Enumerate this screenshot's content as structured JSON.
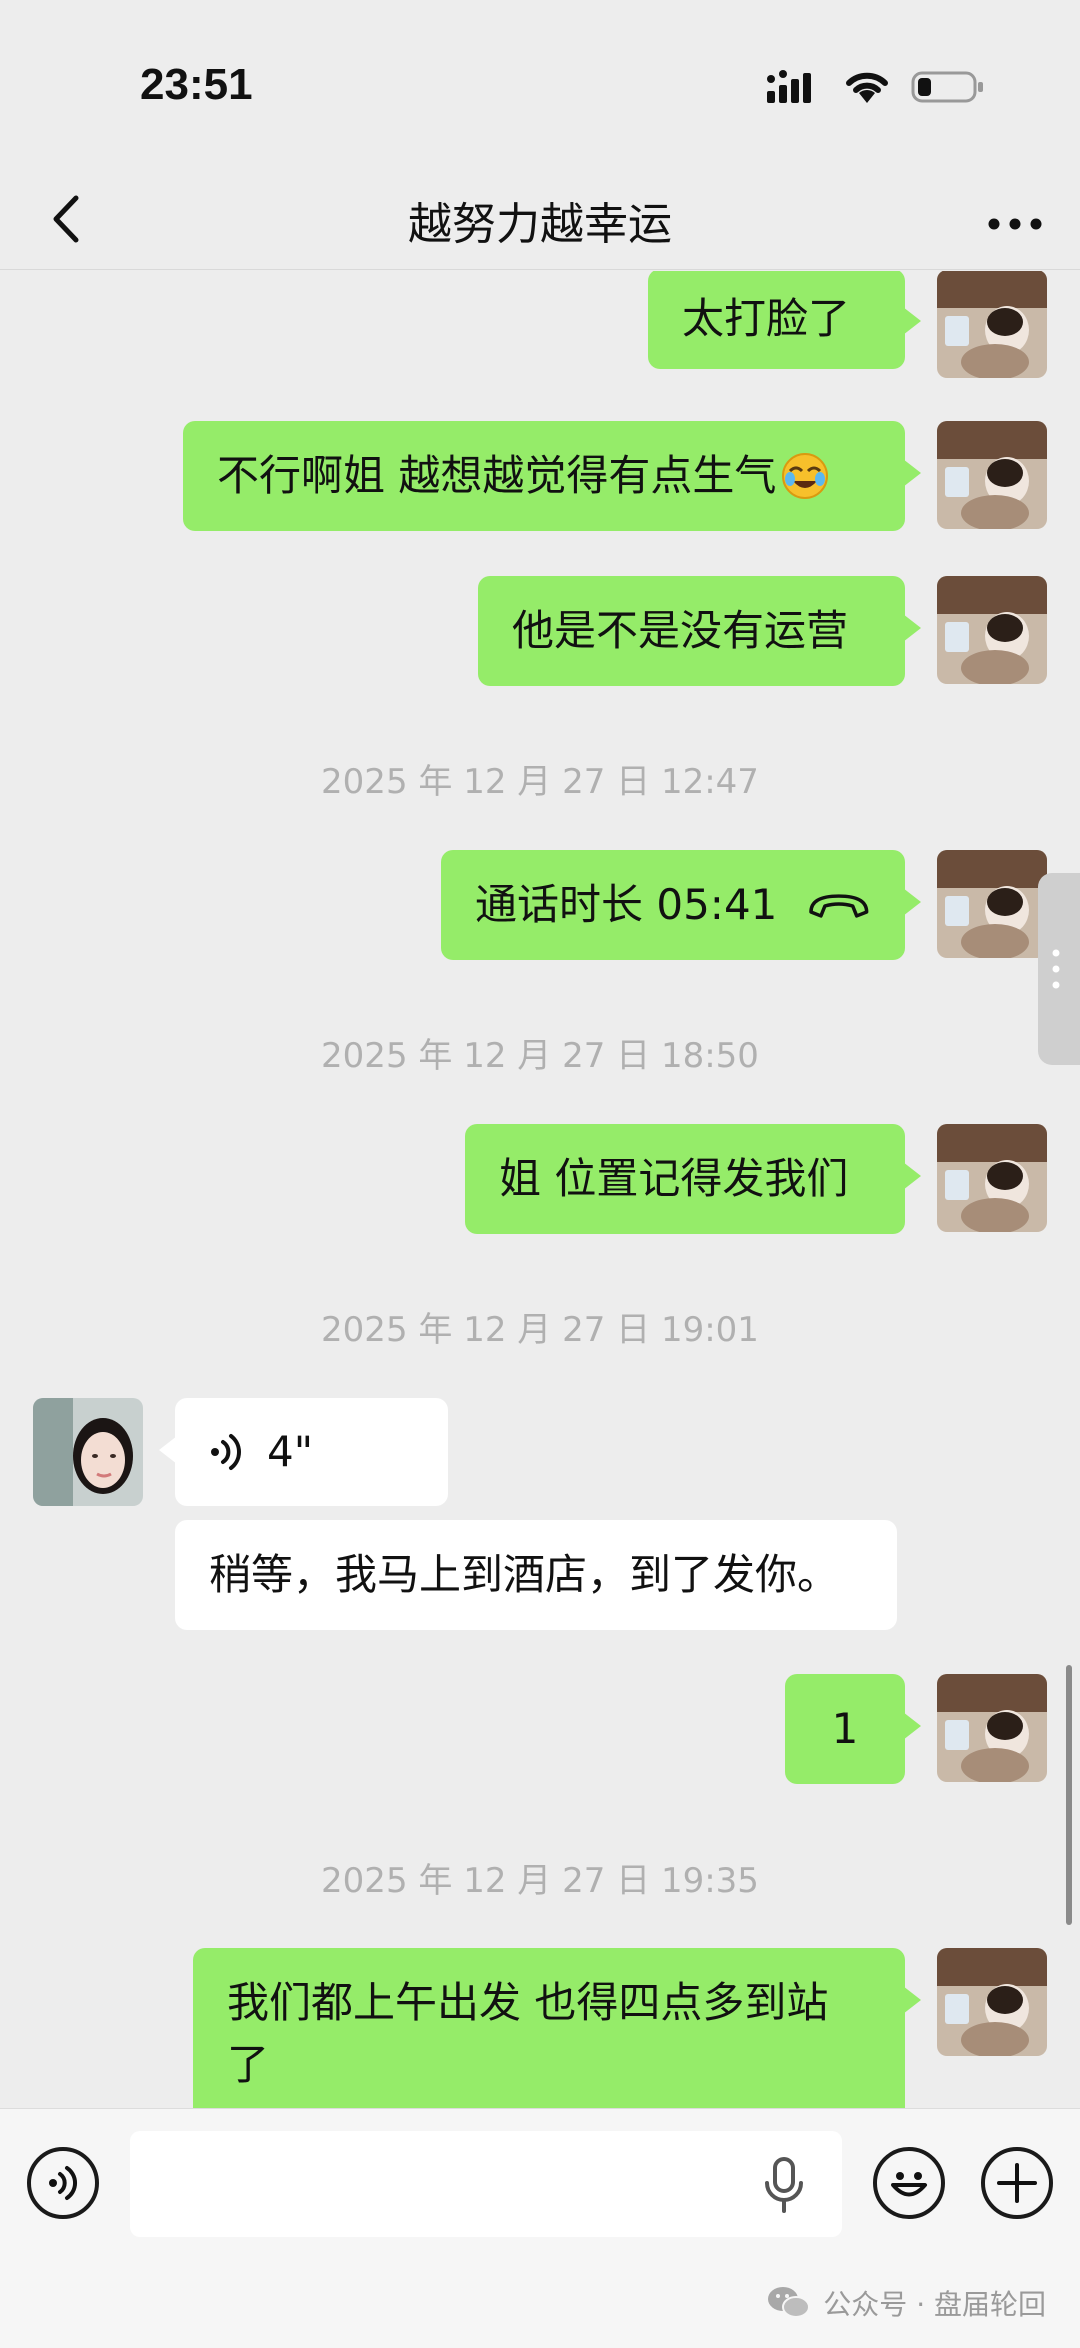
{
  "status": {
    "time": "23:51"
  },
  "nav": {
    "title": "越努力越幸运"
  },
  "messages": {
    "m1": "太打脸了",
    "m2": "不行啊姐 越想越觉得有点生气",
    "m3": "他是不是没有运营",
    "ts1": "2025 年 12 月 27 日 12:47",
    "call_label": "通话时长 05:41",
    "ts2": "2025 年 12 月 27 日 18:50",
    "m4": "姐 位置记得发我们",
    "ts3": "2025 年 12 月 27 日 19:01",
    "voice_duration": "4\"",
    "m5": "稍等，我马上到酒店，到了发你。",
    "m6": "1",
    "ts4": "2025 年 12 月 27 日 19:35",
    "m7_line1": "我们都上午出发 也得四点多到站",
    "m7_line2": "了"
  },
  "watermark": {
    "text": "公众号 · 盘届轮回"
  },
  "colors": {
    "my_bubble": "#95ec69",
    "other_bubble": "#ffffff",
    "background": "#ededed",
    "timestamp": "#b0b0b0"
  },
  "icons": [
    "back-arrow-icon",
    "more-dots-icon",
    "signal-icon",
    "wifi-icon",
    "battery-icon",
    "hangup-phone-icon",
    "voice-wave-icon",
    "voice-input-icon",
    "microphone-icon",
    "emoji-icon",
    "plus-icon",
    "wechat-logo-icon"
  ]
}
